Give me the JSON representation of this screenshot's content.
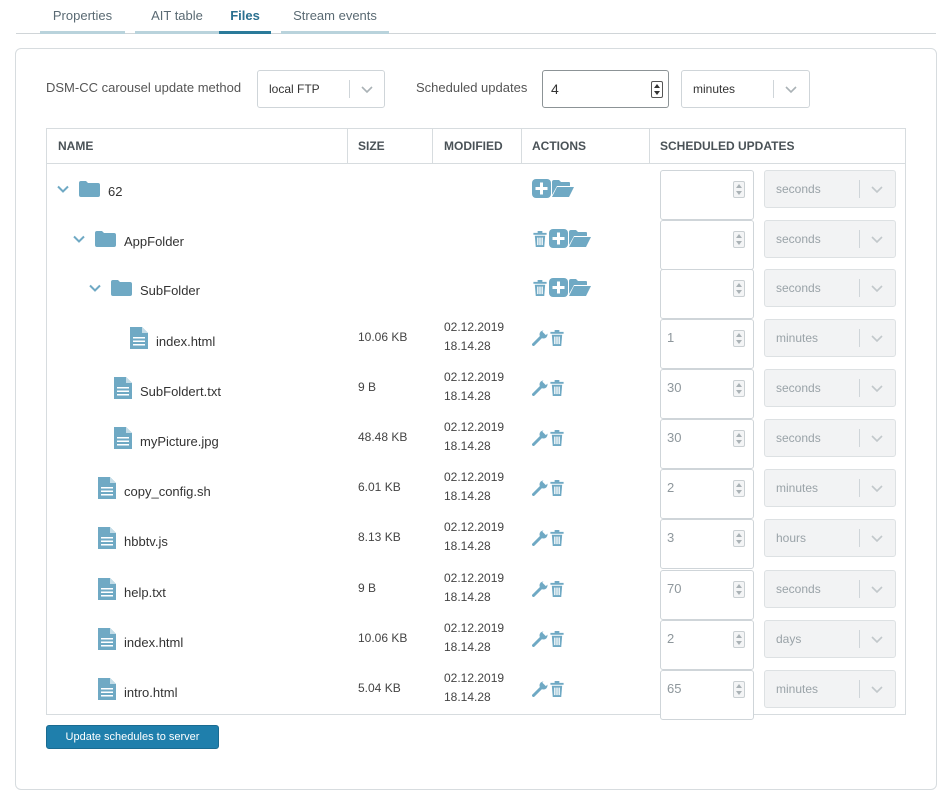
{
  "tabs": [
    {
      "label": "Properties"
    },
    {
      "label": "AIT table"
    },
    {
      "label": "Files"
    },
    {
      "label": "Stream events"
    }
  ],
  "config": {
    "method_label": "DSM-CC carousel update method",
    "method_value": "local FTP",
    "scheduled_label": "Scheduled updates",
    "scheduled_value": "4",
    "scheduled_unit": "minutes"
  },
  "table": {
    "headers": {
      "name": "NAME",
      "size": "SIZE",
      "modified": "MODIFIED",
      "actions": "ACTIONS",
      "scheduled": "SCHEDULED UPDATES"
    },
    "rows": [
      {
        "name": "62",
        "size": "",
        "date": "",
        "time": "",
        "sched": "",
        "unit": "seconds"
      },
      {
        "name": "AppFolder",
        "size": "",
        "date": "",
        "time": "",
        "sched": "",
        "unit": "seconds"
      },
      {
        "name": "SubFolder",
        "size": "",
        "date": "",
        "time": "",
        "sched": "",
        "unit": "seconds"
      },
      {
        "name": "index.html",
        "size": "10.06 KB",
        "date": "02.12.2019",
        "time": "18.14.28",
        "sched": "1",
        "unit": "minutes"
      },
      {
        "name": "SubFoldert.txt",
        "size": "9 B",
        "date": "02.12.2019",
        "time": "18.14.28",
        "sched": "30",
        "unit": "seconds"
      },
      {
        "name": "myPicture.jpg",
        "size": "48.48 KB",
        "date": "02.12.2019",
        "time": "18.14.28",
        "sched": "30",
        "unit": "seconds"
      },
      {
        "name": "copy_config.sh",
        "size": "6.01 KB",
        "date": "02.12.2019",
        "time": "18.14.28",
        "sched": "2",
        "unit": "minutes"
      },
      {
        "name": "hbbtv.js",
        "size": "8.13 KB",
        "date": "02.12.2019",
        "time": "18.14.28",
        "sched": "3",
        "unit": "hours"
      },
      {
        "name": "help.txt",
        "size": "9 B",
        "date": "02.12.2019",
        "time": "18.14.28",
        "sched": "70",
        "unit": "seconds"
      },
      {
        "name": "index.html",
        "size": "10.06 KB",
        "date": "02.12.2019",
        "time": "18.14.28",
        "sched": "2",
        "unit": "days"
      },
      {
        "name": "intro.html",
        "size": "5.04 KB",
        "date": "02.12.2019",
        "time": "18.14.28",
        "sched": "65",
        "unit": "minutes"
      }
    ]
  },
  "button": {
    "label": "Update schedules to server"
  },
  "colors": {
    "accent": "#1f7fac",
    "icon": "#6fa9c4",
    "active_tab": "#2a7090"
  },
  "icons": {
    "expand": "chevron-down-icon",
    "folder": "folder-icon",
    "file": "file-icon",
    "add": "plus-square-icon",
    "open": "folder-open-icon",
    "delete": "trash-icon",
    "edit": "wrench-icon"
  }
}
